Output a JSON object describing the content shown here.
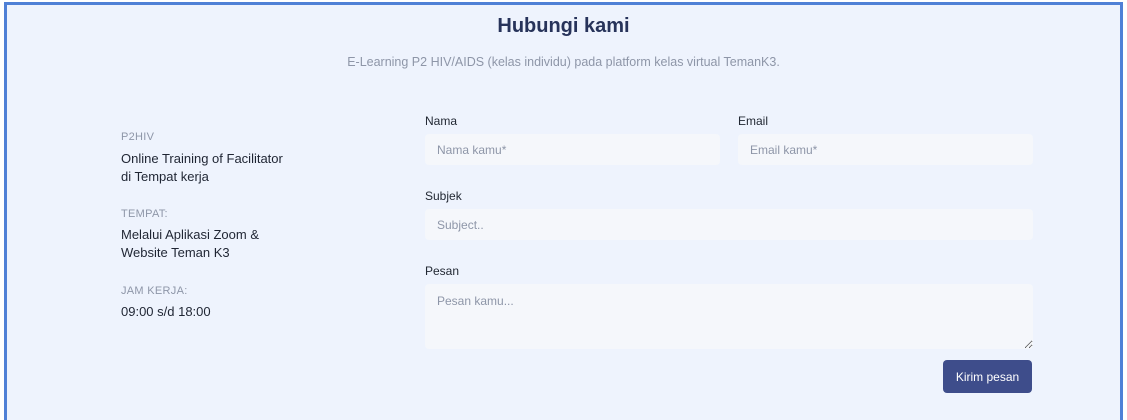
{
  "header": {
    "title": "Hubungi kami",
    "subtitle": "E-Learning P2 HIV/AIDS (kelas individu) pada platform kelas virtual TemanK3."
  },
  "info": {
    "org_label": "P2HIV",
    "org_line1": "Online Training of Facilitator",
    "org_line2": "di Tempat kerja",
    "place_label": "TEMPAT:",
    "place_line1": "Melalui Aplikasi Zoom &",
    "place_line2": "Website Teman K3",
    "hours_label": "JAM KERJA:",
    "hours_value": "09:00 s/d 18:00"
  },
  "form": {
    "name_label": "Nama",
    "name_placeholder": "Nama kamu*",
    "email_label": "Email",
    "email_placeholder": "Email kamu*",
    "subject_label": "Subjek",
    "subject_placeholder": "Subject..",
    "message_label": "Pesan",
    "message_placeholder": "Pesan kamu...",
    "submit_label": "Kirim pesan"
  },
  "colors": {
    "frame_border": "#4f80d6",
    "background": "#eef3fd",
    "button": "#3e4d8b"
  }
}
